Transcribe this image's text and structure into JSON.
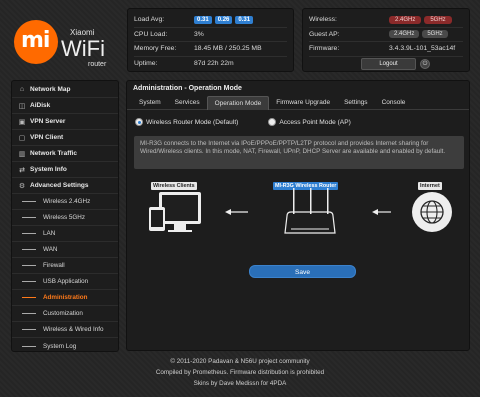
{
  "logo": {
    "mi": "mi",
    "brand": "Xiaomi",
    "product": "WiFi",
    "sub": "router"
  },
  "status": {
    "load_label": "Load Avg:",
    "load_values": [
      "0.31",
      "0.26",
      "0.31"
    ],
    "cpu_label": "CPU Load:",
    "cpu_value": "3%",
    "mem_label": "Memory Free:",
    "mem_value": "18.45 MB / 250.25 MB",
    "uptime_label": "Uptime:",
    "uptime_value": "87d 22h 22m"
  },
  "network": {
    "wireless_label": "Wireless:",
    "wireless_bands": [
      "2.4GHz",
      "5GHz"
    ],
    "guest_label": "Guest AP:",
    "guest_bands": [
      "2.4GHz",
      "5GHz"
    ],
    "firmware_label": "Firmware:",
    "firmware_value": "3.4.3.9L-101_53ac14f",
    "logout_label": "Logout",
    "power_icon": "power-icon"
  },
  "sidebar": {
    "items": [
      {
        "label": "Network Map",
        "icon": "home-icon"
      },
      {
        "label": "AiDisk",
        "icon": "disk-icon"
      },
      {
        "label": "VPN Server",
        "icon": "vpn-server-icon"
      },
      {
        "label": "VPN Client",
        "icon": "vpn-client-icon"
      },
      {
        "label": "Network Traffic",
        "icon": "traffic-icon"
      },
      {
        "label": "System Info",
        "icon": "info-icon"
      },
      {
        "label": "Advanced Settings",
        "icon": "gear-icon"
      }
    ],
    "subitems": [
      "Wireless 2.4GHz",
      "Wireless 5GHz",
      "LAN",
      "WAN",
      "Firewall",
      "USB Application",
      "Administration",
      "Customization",
      "Wireless & Wired Info",
      "System Log"
    ],
    "active_subitem": "Administration"
  },
  "main": {
    "title": "Administration - Operation Mode",
    "tabs": [
      "System",
      "Services",
      "Operation Mode",
      "Firmware Upgrade",
      "Settings",
      "Console"
    ],
    "active_tab": "Operation Mode",
    "mode1": "Wireless Router Mode (Default)",
    "mode2": "Access Point Mode (AP)",
    "description": "MI-R3G connects to the Internet via IPoE/PPPoE/PPTP/L2TP protocol and provides Internet sharing for Wired/Wireless clients. In this mode, NAT, Firewall, UPnP, DHCP Server are available and enabled by default.",
    "diagram": {
      "clients_label": "Wireless Clients",
      "router_label": "MI-R3G Wireless Router",
      "internet_label": "Internet"
    },
    "save_label": "Save"
  },
  "footer": {
    "line1": "© 2011-2020 Padavan & N56U project community",
    "line2": "Compiled by Prometheus. Firmware distribution is prohibited",
    "line3": "Skins by Dave Medissn for 4PDA"
  },
  "colors": {
    "accent": "#ff6a00",
    "active": "#ff7a1a",
    "blue": "#2f7fd1",
    "red_badge": "#8b2a2a"
  }
}
